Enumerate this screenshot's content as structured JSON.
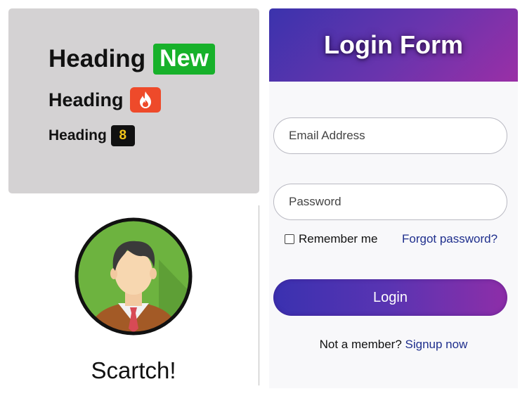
{
  "headings": {
    "h1": {
      "text": "Heading",
      "badge": "New"
    },
    "h2": {
      "text": "Heading",
      "badge_icon": "fire-icon"
    },
    "h3": {
      "text": "Heading",
      "badge": "8"
    }
  },
  "profile": {
    "avatar_icon": "user-avatar-icon",
    "caption": "Scartch!"
  },
  "login": {
    "title": "Login Form",
    "email_placeholder": "Email Address",
    "password_placeholder": "Password",
    "remember_label": "Remember me",
    "forgot_label": "Forgot password?",
    "submit_label": "Login",
    "signup_prompt": "Not a member?",
    "signup_link": "Signup now"
  },
  "colors": {
    "badge_new": "#17b12a",
    "badge_fire": "#ee4a2a",
    "badge_number_bg": "#111111",
    "badge_number_text": "#f2c51a",
    "gradient_start": "#3b33ad",
    "gradient_end": "#9a2fa6",
    "link": "#1f2f8d"
  }
}
